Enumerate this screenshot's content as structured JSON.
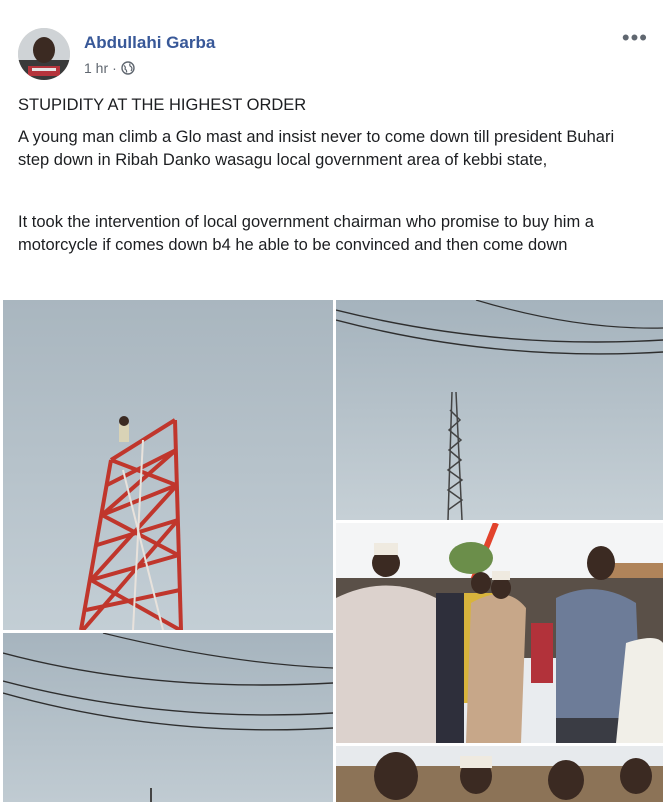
{
  "post": {
    "author": "Abdullahi Garba",
    "time": "1 hr",
    "separator": "·",
    "privacy_icon": "globe-icon",
    "more_label": "•••",
    "headline": "STUPIDITY AT THE HIGHEST ORDER",
    "paragraph1": "A young man climb a Glo mast and insist never to come down till president Buhari step down in Ribah Danko wasagu local government area of kebbi state,",
    "paragraph2": "It took the intervention of local government chairman who promise to buy him a motorcycle if comes down b4 he able to be convinced and then come down"
  },
  "colors": {
    "author": "#385898",
    "meta": "#606770",
    "sky": "#b9c6cf",
    "tower_red": "#c0362c"
  },
  "photos": [
    {
      "name": "photo-tower-closeup",
      "subject": "man on red and white mast"
    },
    {
      "name": "photo-tower-distant",
      "subject": "distant mast with power lines"
    },
    {
      "name": "photo-crowd",
      "subject": "crowd of men gathered"
    },
    {
      "name": "photo-power-lines",
      "subject": "sky with power lines"
    },
    {
      "name": "photo-crowd-2",
      "subject": "crowd close-up"
    }
  ]
}
